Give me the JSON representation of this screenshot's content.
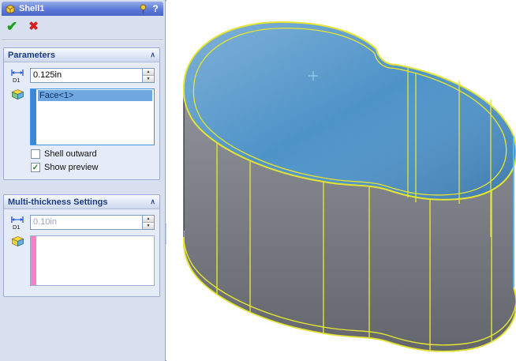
{
  "panel": {
    "title": "Shell1",
    "help_glyph": "?",
    "ok_glyph": "✔",
    "cancel_glyph": "✖",
    "collapse_glyph": "∧",
    "flyout_glyph": "◀",
    "spinner_up": "▲",
    "spinner_down": "▼",
    "parameters": {
      "header": "Parameters",
      "d1_label": "D1",
      "thickness_value": "0.125in",
      "selection_items": [
        "Face<1>"
      ],
      "shell_outward": {
        "label": "Shell outward",
        "check_glyph": ""
      },
      "show_preview": {
        "label": "Show preview",
        "check_glyph": "✓"
      }
    },
    "multi_thickness": {
      "header": "Multi-thickness Settings",
      "d1_label": "D1",
      "thickness_value": "0.10in",
      "selection_items": []
    }
  },
  "viewport": {
    "origin_marker": "+",
    "colors": {
      "selected_face": "#4e93c8",
      "preview_edge": "#e4e432",
      "highlight_edge": "#57c8f2",
      "body_light": "#90949a",
      "body_dark": "#63676d",
      "selection_stripe_blue": "#3d87d8",
      "multi_thickness_stripe_pink": "#f781c3",
      "selected_item_bg": "#6fa8e0"
    }
  }
}
